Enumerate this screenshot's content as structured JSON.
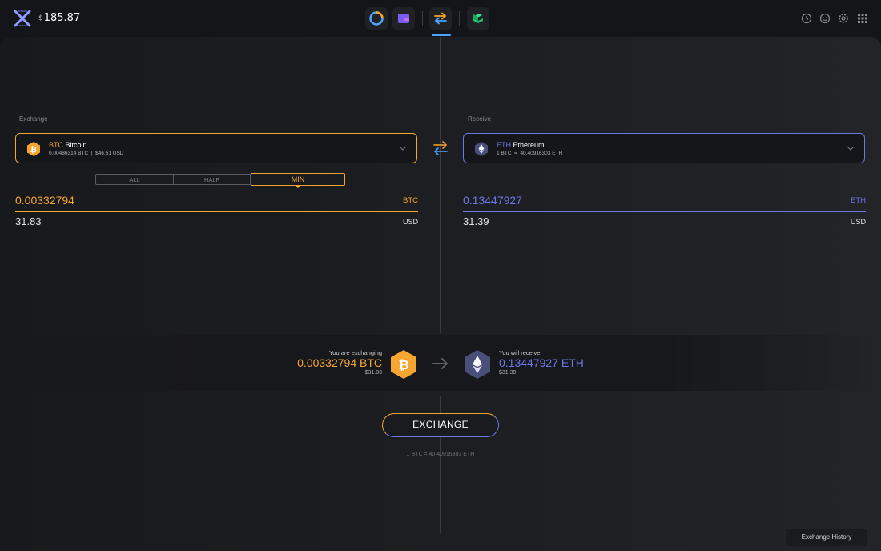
{
  "header": {
    "currency_symbol": "$",
    "balance": "185.87",
    "nav": [
      {
        "name": "portfolio-icon"
      },
      {
        "name": "wallet-icon"
      },
      {
        "name": "exchange-icon",
        "active": true
      },
      {
        "name": "staking-icon"
      }
    ],
    "right_icons": [
      "history-icon",
      "smiley-icon",
      "gear-icon",
      "apps-grid-icon"
    ]
  },
  "exchange": {
    "label": "Exchange",
    "ticker": "BTC",
    "name": "Bitcoin",
    "balance_line": "0.00486314 BTC  |  $46.51 USD",
    "amount_tabs": [
      "ALL",
      "HALF",
      "MIN"
    ],
    "selected_tab": "MIN",
    "amount": "0.00332794",
    "amount_unit": "BTC",
    "usd_amount": "31.83",
    "usd_unit": "USD"
  },
  "receive": {
    "label": "Receive",
    "ticker": "ETH",
    "name": "Ethereum",
    "rate_line": "1 BTC  =  40.40916303 ETH",
    "amount": "0.13447927",
    "amount_unit": "ETH",
    "usd_amount": "31.39",
    "usd_unit": "USD"
  },
  "summary": {
    "exchanging_label": "You are exchanging",
    "exchanging_amount": "0.00332794 BTC",
    "exchanging_usd": "$31.83",
    "receive_label": "You will receive",
    "receive_amount": "0.13447927 ETH",
    "receive_usd": "$31.39"
  },
  "actions": {
    "exchange_button": "EXCHANGE",
    "rate_text": "1 BTC = 40.40916303 ETH",
    "history_button": "Exchange History"
  },
  "colors": {
    "btc": "#f7a531",
    "eth": "#6d76e8",
    "background": "#141518"
  }
}
